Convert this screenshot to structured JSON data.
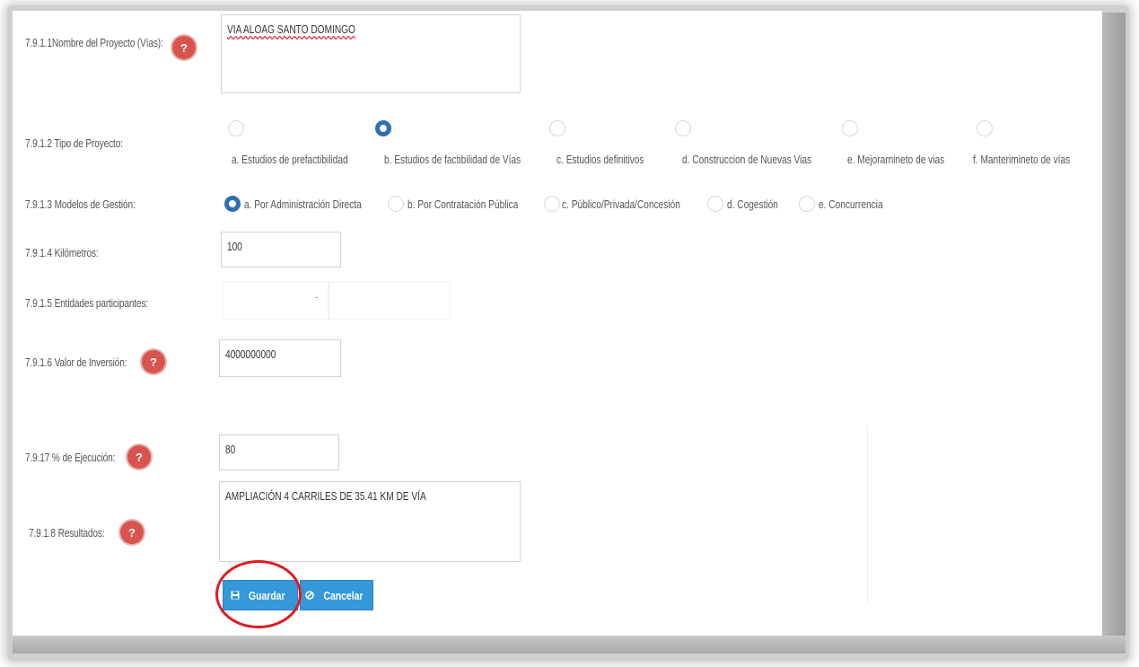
{
  "fields": {
    "nombre": {
      "label": "7.9.1.1Nombre del Proyecto (Vías):",
      "value": "VIA ALOAG SANTO DOMINGO"
    },
    "tipo": {
      "label": "7.9.1.2 Tipo de Proyecto:",
      "options": [
        "a. Estudios de prefactibilidad",
        "b. Estudios de factibilidad de Vías",
        "c. Estudios definitivos",
        "d. Construccion de Nuevas Vias",
        "e. Mejorarnineto de vias",
        "f. Manterimineto de vías"
      ],
      "selected": "b. Estudios de factibilidad de Vías"
    },
    "modelos": {
      "label": "7.9.1.3 Modelos de Gestión:",
      "options": [
        "a. Por Administración Directa",
        "b. Por Contratación Pública",
        "c. Público/Privada/Concesión",
        "d. Cogestión",
        "e. Concurrencia"
      ],
      "selected": "a. Por Administración Directa"
    },
    "kilometros": {
      "label": "7.9.1.4 Kilómetros:",
      "value": "100"
    },
    "entidades": {
      "label": "7.9.1.5 Entidades participantes:",
      "separator": "-"
    },
    "valor": {
      "label": "7.9.1.6 Valor de Inversión:",
      "value": "4000000000"
    },
    "ejecucion": {
      "label": "7.9.17 % de Ejecución:",
      "value": "80"
    },
    "resultados": {
      "label": "7.9.1.8 Resultados:",
      "value": "AMPLIACIÓN 4 CARRILES DE 35.41 KM DE VÍA"
    }
  },
  "help_icon": "?",
  "buttons": {
    "guardar": {
      "label": "Guardar",
      "icon": "save-icon"
    },
    "cancelar": {
      "label": "Cancelar",
      "icon": "cancel-icon"
    }
  },
  "colors": {
    "help": "#d9534f",
    "primary_button": "#3498db",
    "radio_checked": "#2f6fb0",
    "annotation": "#e01b22"
  }
}
